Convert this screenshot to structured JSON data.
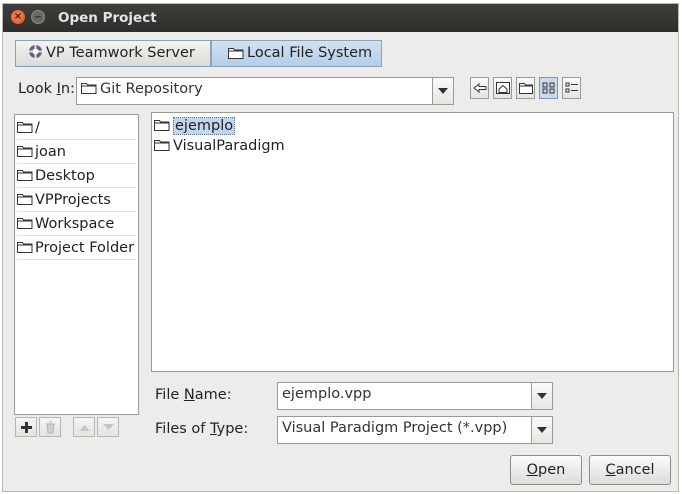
{
  "window": {
    "title": "Open Project"
  },
  "tabs": [
    {
      "label": "VP Teamwork Server",
      "icon": "teamwork-server-icon",
      "active": false
    },
    {
      "label": "Local File System",
      "icon": "folder-icon",
      "active": true
    }
  ],
  "look_in": {
    "label_pre": "Look ",
    "label_mnemonic": "I",
    "label_post": "n:",
    "value": "Git Repository"
  },
  "toolbar": [
    "up-folder-icon",
    "home-folder-icon",
    "new-folder-icon",
    "list-view-icon",
    "details-view-icon"
  ],
  "places": [
    {
      "label": "/"
    },
    {
      "label": "joan"
    },
    {
      "label": "Desktop"
    },
    {
      "label": "VPProjects"
    },
    {
      "label": "Workspace"
    },
    {
      "label": "Project Folder"
    }
  ],
  "places_buttons": [
    "add-icon",
    "delete-icon",
    "move-up-icon",
    "move-down-icon"
  ],
  "files": [
    {
      "name": "ejemplo",
      "selected": true
    },
    {
      "name": "VisualParadigm",
      "selected": false
    }
  ],
  "file_name": {
    "label_pre": "File ",
    "label_mnemonic": "N",
    "label_post": "ame:",
    "value": "ejemplo.vpp"
  },
  "file_type": {
    "label_pre": "Files of ",
    "label_mnemonic": "T",
    "label_post": "ype:",
    "value": "Visual Paradigm Project (*.vpp)"
  },
  "buttons": {
    "open_mnemonic": "O",
    "open_rest": "pen",
    "cancel_mnemonic": "C",
    "cancel_rest": "ancel"
  },
  "colors": {
    "selection": "#c2d6ee",
    "tab_active": "#b4cde8",
    "titlebar": "#3a3936",
    "close_button": "#e0622a"
  }
}
